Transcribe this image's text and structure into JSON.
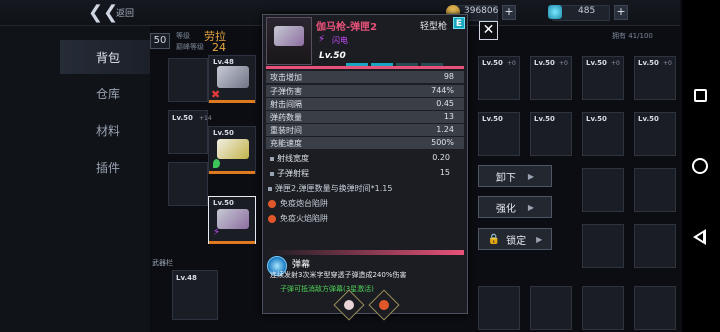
{
  "header": {
    "back_label": "返回",
    "coins": "396806",
    "gems": "485",
    "capacity": "拥有 41/100"
  },
  "nav": {
    "tabs": [
      {
        "label": "背包",
        "active": true
      },
      {
        "label": "仓库",
        "active": false
      },
      {
        "label": "材料",
        "active": false
      },
      {
        "label": "插件",
        "active": false
      }
    ]
  },
  "player": {
    "level": "50",
    "grade_label": "等级",
    "hero_name": "劳拉",
    "power_label": "巅峰等级",
    "power_value": "24",
    "weapon_slot_label": "武器栏"
  },
  "loadout": {
    "slots": [
      {
        "lv": "Lv.48"
      },
      {
        "lv": "Lv.50"
      },
      {
        "lv": "Lv.50"
      },
      {
        "lv": "Lv.48"
      }
    ]
  },
  "popup": {
    "weapon_name": "伽马枪-弹匣2",
    "weapon_type": "轻型枪",
    "grade": "E",
    "element": "闪电",
    "level": "Lv.50",
    "stats": [
      {
        "label": "攻击增加",
        "value": "98"
      },
      {
        "label": "子弹伤害",
        "value": "744%"
      },
      {
        "label": "射击间隔",
        "value": "0.45"
      },
      {
        "label": "弹药数量",
        "value": "13"
      },
      {
        "label": "重装时间",
        "value": "1.24"
      },
      {
        "label": "充能速度",
        "value": "500%"
      }
    ],
    "extras": [
      {
        "label": "射线宽度",
        "value": "0.20"
      },
      {
        "label": "子弹射程",
        "value": "15"
      }
    ],
    "effect_note": "弹匣2,弹匣数量与换弹时间*1.15",
    "immunities": [
      "免疫炮台陷阱",
      "免疫火焰陷阱"
    ],
    "skill": {
      "title": "弹幕",
      "desc": "连续发射3次米字型穿透子弹造成240%伤害",
      "note": "子弹可抵消敌方弹幕(3星激活)"
    }
  },
  "actions": {
    "unequip": "卸下",
    "enhance": "强化",
    "lock": "锁定"
  },
  "grid": {
    "levels": [
      "Lv.50",
      "Lv.50",
      "Lv.50",
      "Lv.50",
      "Lv.50"
    ],
    "plus": "+0"
  },
  "colors": {
    "rarity_orange": "#e07a1e",
    "weapon_name": "#e8527a",
    "grade_e": "#1aa6c0",
    "element": "#c94bff"
  }
}
